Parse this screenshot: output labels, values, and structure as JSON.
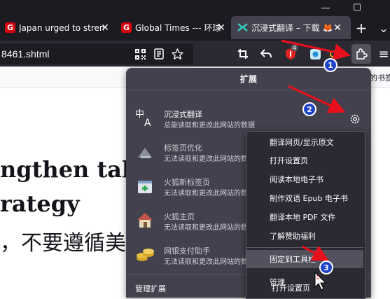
{
  "window": {
    "controls": {
      "minimize": "—",
      "maximize": "☐"
    }
  },
  "tabs": [
    {
      "title": "Japan urged to strengthen talks, refrain from following US strategy",
      "favicon_letter": "G",
      "close": "✕"
    },
    {
      "title": "Global Times --- 环球时报",
      "favicon_letter": "G",
      "close": "✕"
    },
    {
      "title": "沉浸式翻译 – 下载 🦊",
      "close": "✕",
      "active": true
    }
  ],
  "tab_actions": {
    "new_tab": "+",
    "list_all_tabs": "⌄"
  },
  "address_bar": {
    "url": "8461.shtml"
  },
  "toolbar": {
    "extension_badge_count": "4",
    "menu": "≡"
  },
  "bookmarks_bar": {
    "overflow_text": "的书签"
  },
  "page": {
    "lines": [
      "ngthen talks,",
      "rategy",
      "，不要遵循美"
    ]
  },
  "extensions_panel": {
    "title": "扩展",
    "items": [
      {
        "name": "沉浸式翻译",
        "desc": "总能读取和更改此网站的数据"
      },
      {
        "name": "标签页优化",
        "desc": "无法读取和更改此网站的数据"
      },
      {
        "name": "火狐新标签页",
        "desc": "无法读取和更改此网站的数据"
      },
      {
        "name": "火狐主页",
        "desc": "无法读取和更改此网站的数据"
      },
      {
        "name": "网银支付助手",
        "desc": "无法读取和更改此网站的数据"
      }
    ],
    "manage_label": "管理扩展"
  },
  "context_menu": {
    "items": [
      "翻译网页/显示原文",
      "打开设置页",
      "阅读本地电子书",
      "制作双语 Epub 电子书",
      "翻译本地 PDF 文件",
      "了解赞助福利",
      "固定到工具栏",
      "管理",
      "打开设置页"
    ],
    "highlighted_index": 6
  },
  "annotations": {
    "badges": [
      "1",
      "2",
      "3"
    ],
    "color": "#e8101c",
    "badge_color": "#1e43c8"
  }
}
